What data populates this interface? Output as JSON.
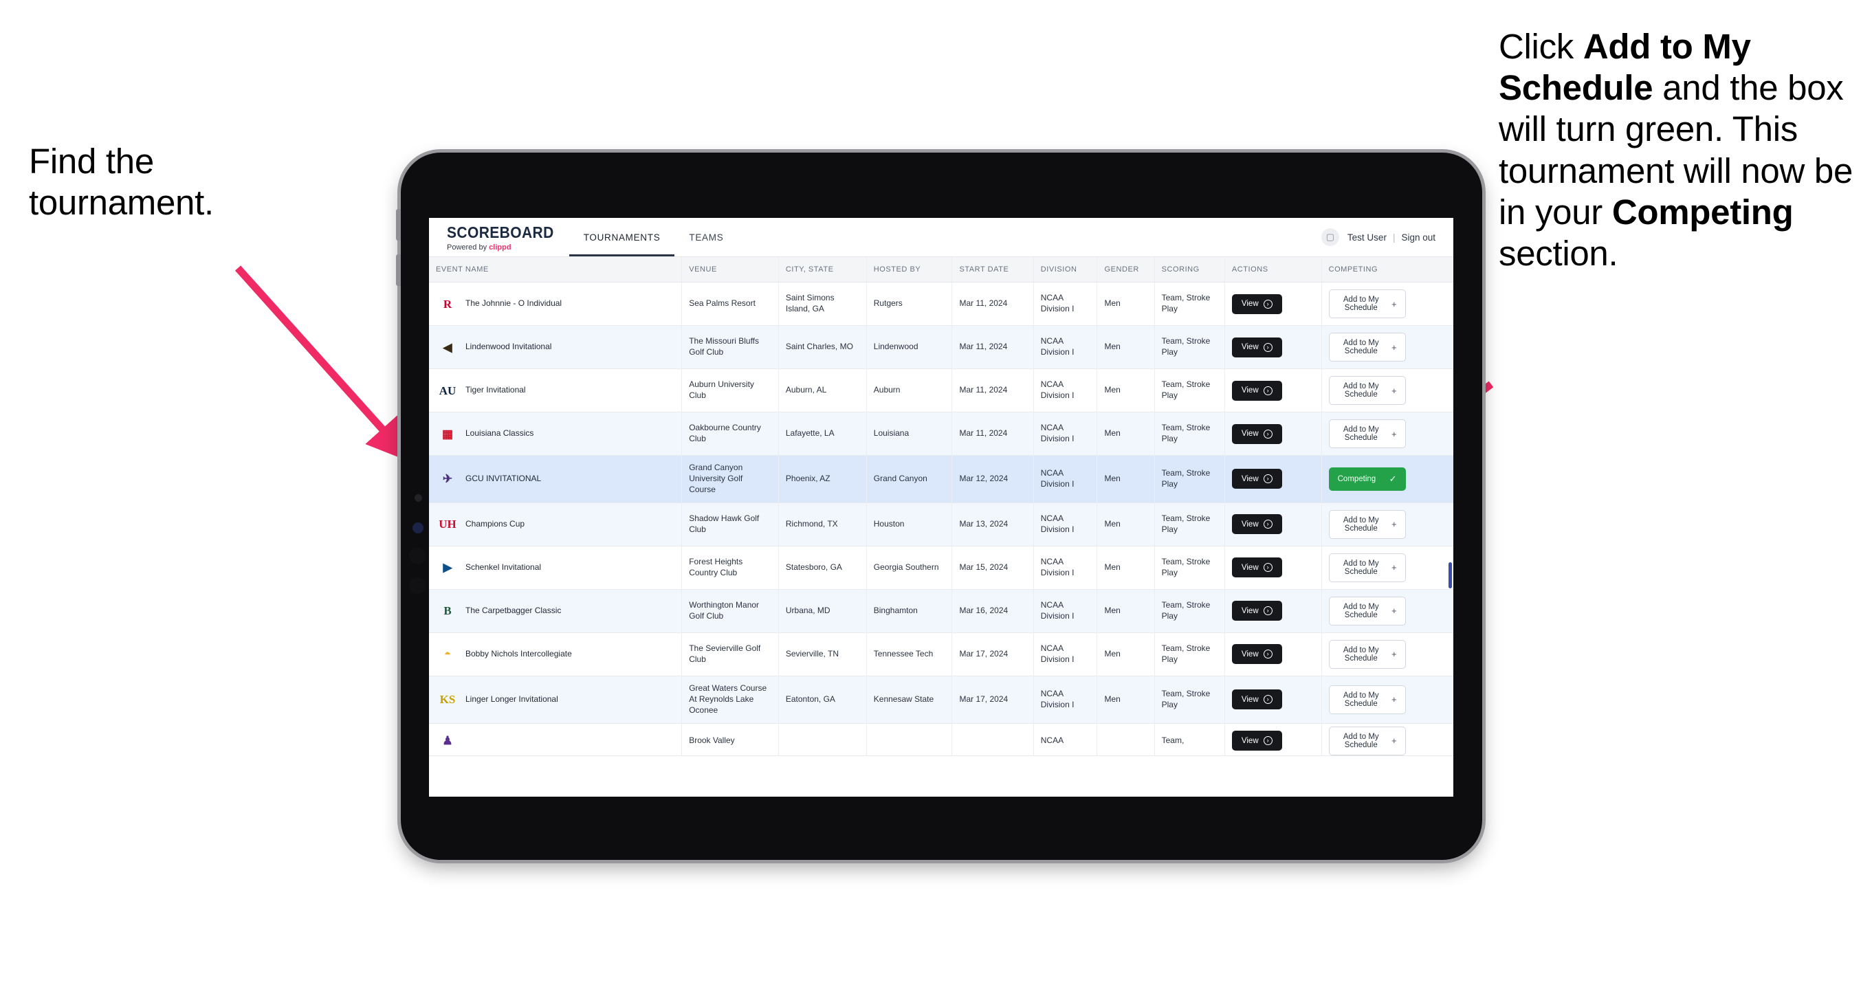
{
  "annotations": {
    "left": "Find the tournament.",
    "right_parts": [
      {
        "text": "Click ",
        "bold": false
      },
      {
        "text": "Add to My Schedule",
        "bold": true
      },
      {
        "text": " and the box will turn green. This tournament will now be in your ",
        "bold": false
      },
      {
        "text": "Competing",
        "bold": true
      },
      {
        "text": " section.",
        "bold": false
      }
    ],
    "arrow_color": "#ef2a64"
  },
  "app": {
    "brand_title": "SCOREBOARD",
    "brand_sub_prefix": "Powered by ",
    "brand_sub_name": "clippd",
    "tabs": [
      {
        "label": "TOURNAMENTS",
        "active": true
      },
      {
        "label": "TEAMS",
        "active": false
      }
    ],
    "user_name": "Test User",
    "separator": "|",
    "sign_out": "Sign out",
    "avatar_icon": "user-icon"
  },
  "table": {
    "columns": [
      "EVENT NAME",
      "VENUE",
      "CITY, STATE",
      "HOSTED BY",
      "START DATE",
      "DIVISION",
      "GENDER",
      "SCORING",
      "ACTIONS",
      "COMPETING"
    ],
    "view_label": "View",
    "add_label": "Add to My Schedule",
    "add_icon": "plus-icon",
    "competing_label": "Competing",
    "competing_icon": "check-icon",
    "competing_color": "#23a24a",
    "highlight_color": "#dbe8fb",
    "rows": [
      {
        "logo_text": "R",
        "logo_color": "#cc0033",
        "event": "The Johnnie - O Individual",
        "venue": "Sea Palms Resort",
        "city": "Saint Simons Island, GA",
        "host": "Rutgers",
        "date": "Mar 11, 2024",
        "division": "NCAA Division I",
        "gender": "Men",
        "scoring": "Team, Stroke Play",
        "competing": false
      },
      {
        "logo_text": "◀",
        "logo_color": "#3a2a14",
        "event": "Lindenwood Invitational",
        "venue": "The Missouri Bluffs Golf Club",
        "city": "Saint Charles, MO",
        "host": "Lindenwood",
        "date": "Mar 11, 2024",
        "division": "NCAA Division I",
        "gender": "Men",
        "scoring": "Team, Stroke Play",
        "competing": false
      },
      {
        "logo_text": "AU",
        "logo_color": "#0c2340",
        "event": "Tiger Invitational",
        "venue": "Auburn University Club",
        "city": "Auburn, AL",
        "host": "Auburn",
        "date": "Mar 11, 2024",
        "division": "NCAA Division I",
        "gender": "Men",
        "scoring": "Team, Stroke Play",
        "competing": false
      },
      {
        "logo_text": "▦",
        "logo_color": "#ce1126",
        "event": "Louisiana Classics",
        "venue": "Oakbourne Country Club",
        "city": "Lafayette, LA",
        "host": "Louisiana",
        "date": "Mar 11, 2024",
        "division": "NCAA Division I",
        "gender": "Men",
        "scoring": "Team, Stroke Play",
        "competing": false
      },
      {
        "logo_text": "✈",
        "logo_color": "#4b2e83",
        "event": "GCU INVITATIONAL",
        "venue": "Grand Canyon University Golf Course",
        "city": "Phoenix, AZ",
        "host": "Grand Canyon",
        "date": "Mar 12, 2024",
        "division": "NCAA Division I",
        "gender": "Men",
        "scoring": "Team, Stroke Play",
        "competing": true,
        "highlighted": true
      },
      {
        "logo_text": "UH",
        "logo_color": "#c8102e",
        "event": "Champions Cup",
        "venue": "Shadow Hawk Golf Club",
        "city": "Richmond, TX",
        "host": "Houston",
        "date": "Mar 13, 2024",
        "division": "NCAA Division I",
        "gender": "Men",
        "scoring": "Team, Stroke Play",
        "competing": false
      },
      {
        "logo_text": "▶",
        "logo_color": "#0b4e8a",
        "event": "Schenkel Invitational",
        "venue": "Forest Heights Country Club",
        "city": "Statesboro, GA",
        "host": "Georgia Southern",
        "date": "Mar 15, 2024",
        "division": "NCAA Division I",
        "gender": "Men",
        "scoring": "Team, Stroke Play",
        "competing": false
      },
      {
        "logo_text": "B",
        "logo_color": "#1c5c3a",
        "event": "The Carpetbagger Classic",
        "venue": "Worthington Manor Golf Club",
        "city": "Urbana, MD",
        "host": "Binghamton",
        "date": "Mar 16, 2024",
        "division": "NCAA Division I",
        "gender": "Men",
        "scoring": "Team, Stroke Play",
        "competing": false
      },
      {
        "logo_text": "◓",
        "logo_color": "#f0b323",
        "event": "Bobby Nichols Intercollegiate",
        "venue": "The Sevierville Golf Club",
        "city": "Sevierville, TN",
        "host": "Tennessee Tech",
        "date": "Mar 17, 2024",
        "division": "NCAA Division I",
        "gender": "Men",
        "scoring": "Team, Stroke Play",
        "competing": false
      },
      {
        "logo_text": "KS",
        "logo_color": "#c8a300",
        "event": "Linger Longer Invitational",
        "venue": "Great Waters Course At Reynolds Lake Oconee",
        "city": "Eatonton, GA",
        "host": "Kennesaw State",
        "date": "Mar 17, 2024",
        "division": "NCAA Division I",
        "gender": "Men",
        "scoring": "Team, Stroke Play",
        "competing": false
      },
      {
        "logo_text": "♟",
        "logo_color": "#5b2d8e",
        "event": "",
        "venue": "Brook Valley",
        "city": "",
        "host": "",
        "date": "",
        "division": "NCAA",
        "gender": "",
        "scoring": "Team,",
        "competing": false,
        "cut_off": true
      }
    ]
  }
}
